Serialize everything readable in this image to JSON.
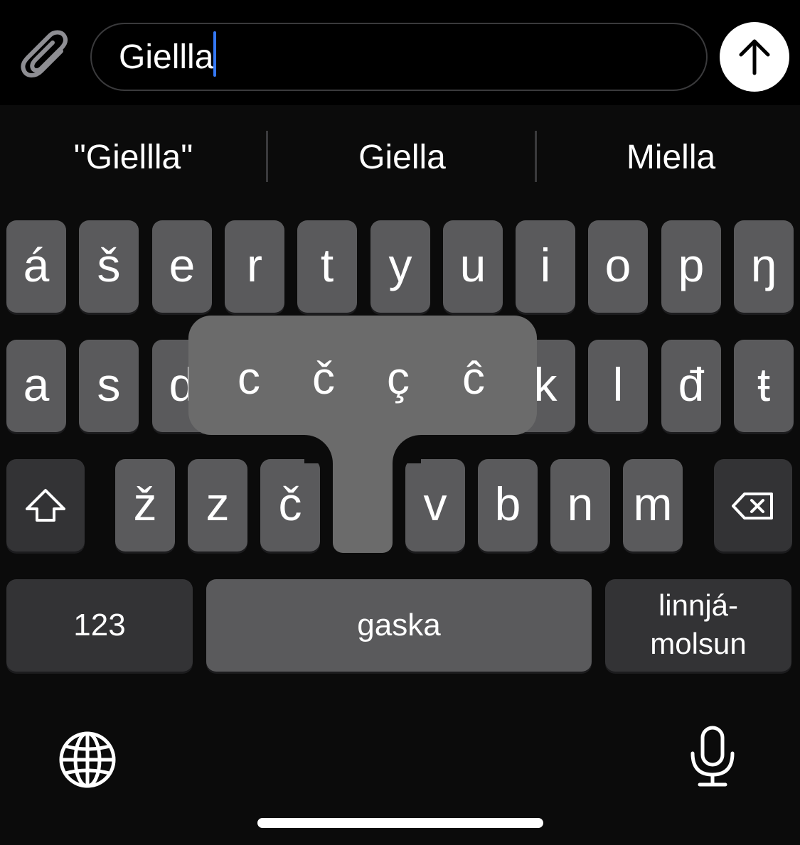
{
  "composer": {
    "text": "Giellla",
    "icons": {
      "attach": "paperclip-icon",
      "send": "arrow-up-icon"
    }
  },
  "suggestions": [
    "\"Giellla\"",
    "Giella",
    "Miella"
  ],
  "rows": {
    "row1": [
      "á",
      "š",
      "e",
      "r",
      "t",
      "y",
      "u",
      "i",
      "o",
      "p",
      "ŋ"
    ],
    "row2": [
      "a",
      "s",
      "d",
      "k",
      "l",
      "đ",
      "ŧ"
    ],
    "row3": [
      "ž",
      "z",
      "č",
      "v",
      "b",
      "n",
      "m"
    ]
  },
  "popup": {
    "chars": [
      "c",
      "č",
      "ç",
      "ĉ"
    ]
  },
  "bottom": {
    "numbers": "123",
    "space": "gaska",
    "return_line1": "linnjá-",
    "return_line2": "molsun"
  },
  "icons": {
    "shift": "shift-icon",
    "delete": "delete-icon",
    "globe": "globe-icon",
    "mic": "microphone-icon"
  }
}
